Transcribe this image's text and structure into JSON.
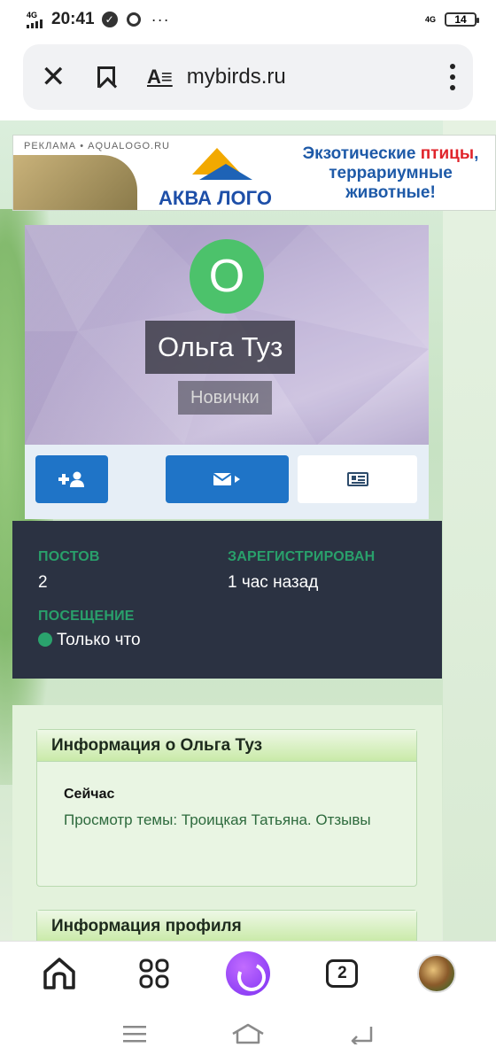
{
  "status_bar": {
    "network_left": "4G",
    "time": "20:41",
    "badge": "✓",
    "more": "···",
    "network_right": "4G",
    "battery": "14"
  },
  "browser": {
    "url": "mybirds.ru",
    "reader_icon": "A≡"
  },
  "ad": {
    "label": "РЕКЛАМА • AQUALOGO.RU",
    "logo_text": "АКВА ЛОГО",
    "slogan_part1": "Экзотические ",
    "slogan_highlight": "птицы",
    "slogan_part2": ", террариумные животные!"
  },
  "profile": {
    "avatar_letter": "О",
    "name": "Ольга Туз",
    "group": "Новички"
  },
  "stats": {
    "posts_label": "ПОСТОВ",
    "posts_value": "2",
    "registered_label": "ЗАРЕГИСТРИРОВАН",
    "registered_value": "1 час назад",
    "visit_label": "ПОСЕЩЕНИЕ",
    "visit_value": "Только что"
  },
  "info": {
    "title": "Информация о Ольга Туз",
    "now_label": "Сейчас",
    "now_text": "Просмотр темы: Троицкая Татьяна. Отзывы"
  },
  "profile_info": {
    "title": "Информация профиля"
  },
  "bottom_nav": {
    "tabs_count": "2"
  },
  "colors": {
    "accent_blue": "#1f74c7",
    "stats_bg": "#2b3242",
    "stat_label_green": "#29a06b",
    "avatar_green": "#4cc26b",
    "alice_purple": "#7b2ff2"
  }
}
